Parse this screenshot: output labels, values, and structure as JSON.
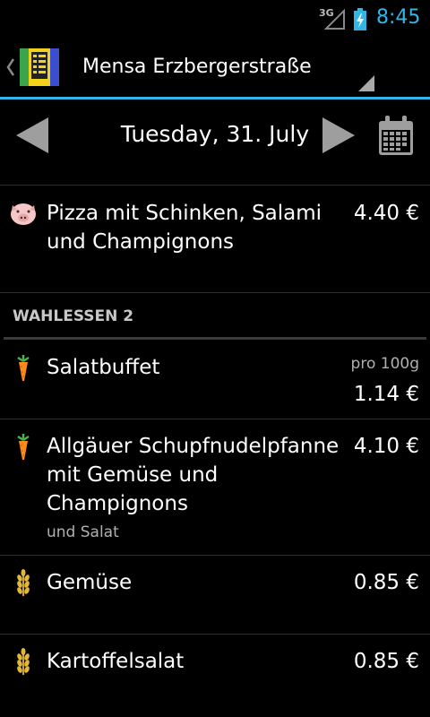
{
  "status": {
    "network": "3G",
    "time": "8:45"
  },
  "actionbar": {
    "title": "Mensa Erzbergerstraße"
  },
  "datebar": {
    "date": "Tuesday, 31. July"
  },
  "meals_top": [
    {
      "name": "Pizza mit Schinken, Salami und Champignons",
      "price": "4.40 €",
      "icon": "pig-icon"
    }
  ],
  "section": {
    "title": "WAHLESSEN 2"
  },
  "meals": [
    {
      "name": "Salatbuffet",
      "unit": "pro 100g",
      "price": "1.14 €",
      "icon": "carrot-icon"
    },
    {
      "name": "Allgäuer Schupfnudelpfanne mit Gemüse und Champignons",
      "note": "und Salat",
      "price": "4.10 €",
      "icon": "carrot-icon"
    },
    {
      "name": "Gemüse",
      "price": "0.85 €",
      "icon": "wheat-icon"
    },
    {
      "name": "Kartoffelsalat",
      "price": "0.85 €",
      "icon": "wheat-icon"
    }
  ],
  "colors": {
    "accent": "#33b5e5",
    "background": "#000000"
  }
}
